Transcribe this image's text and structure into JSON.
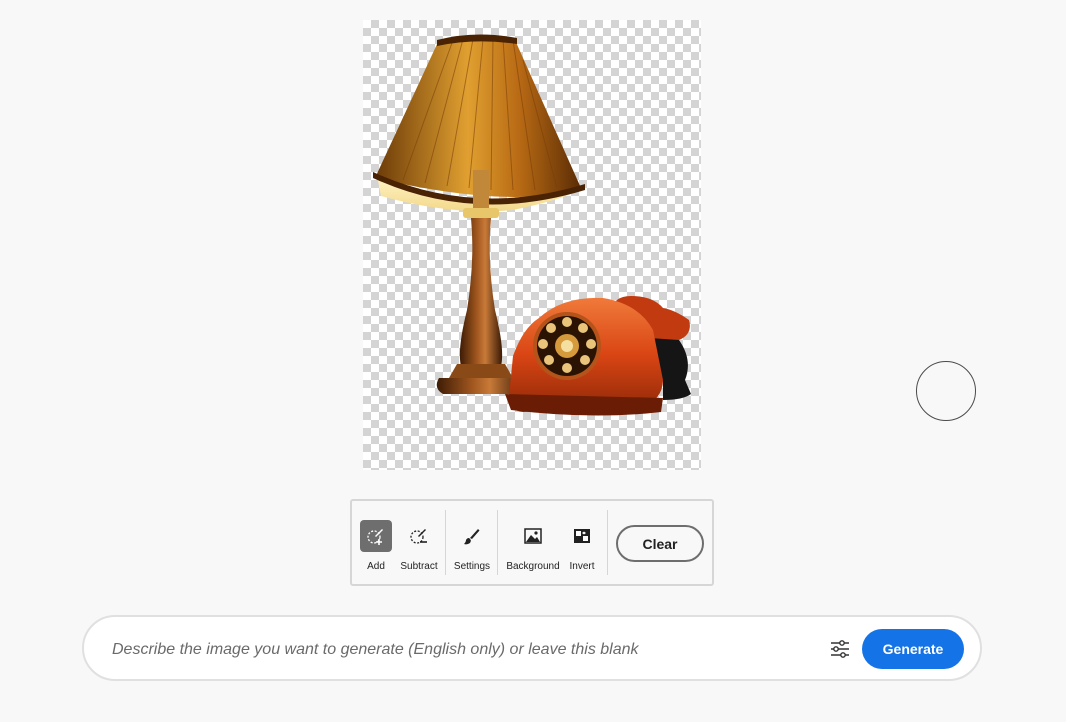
{
  "canvas": {
    "image_alt": "Table lamp with pleated shade and red rotary telephone on transparent background"
  },
  "toolbar": {
    "tools": [
      {
        "label": "Add",
        "icon": "brush-add-icon",
        "active": true
      },
      {
        "label": "Subtract",
        "icon": "brush-subtract-icon",
        "active": false
      },
      {
        "label": "Settings",
        "icon": "brush-icon",
        "active": false
      },
      {
        "label": "Background",
        "icon": "image-icon",
        "active": false
      },
      {
        "label": "Invert",
        "icon": "invert-icon",
        "active": false
      }
    ],
    "clear_label": "Clear"
  },
  "prompt": {
    "placeholder": "Describe the image you want to generate (English only) or leave this blank",
    "value": "",
    "settings_icon": "sliders-icon",
    "generate_label": "Generate"
  },
  "colors": {
    "accent": "#1473e6",
    "active_tool": "#6e6e6e"
  }
}
